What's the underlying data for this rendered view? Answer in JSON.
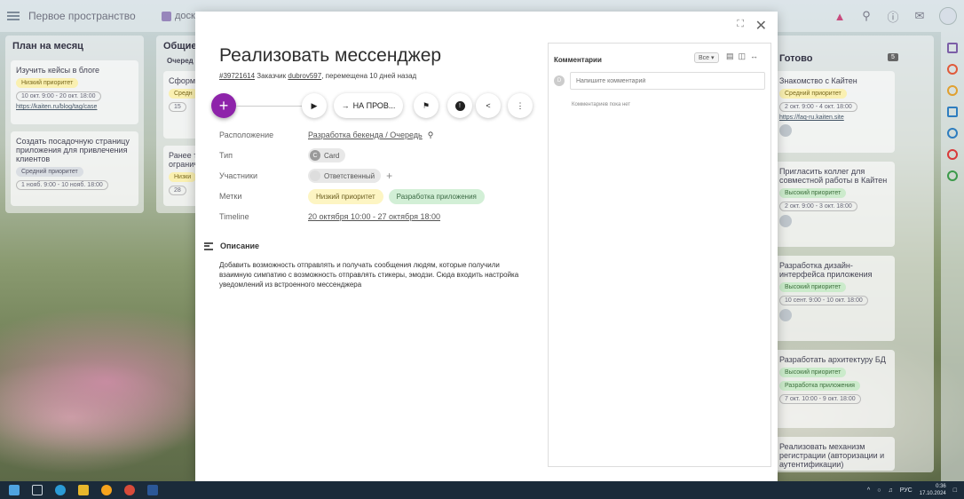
{
  "topbar": {
    "space_name": "Первое пространство",
    "board_label": "доск"
  },
  "columns": {
    "plan": {
      "title": "План на месяц",
      "cards": [
        {
          "text": "Изучить кейсы в блоге",
          "pill": "Низкий приоритет",
          "date": "10 окт. 9:00 - 20 окт. 18:00",
          "link": "https://kaiten.ru/blog/tag/case"
        },
        {
          "text": "Создать посадочную страницу приложения для привлечения клиентов",
          "pill": "Средний приоритет",
          "date": "1 нояб. 9:00 - 10 нояб. 18:00"
        }
      ]
    },
    "general": {
      "title": "Общие",
      "subtitle": "Очеред",
      "cards": [
        {
          "text": "Сформ",
          "pill": "Средн",
          "date": "15"
        },
        {
          "text": "Ранее т огранич",
          "pill": "Низки",
          "date": "28"
        }
      ]
    },
    "done": {
      "title": "Готово",
      "count": "5",
      "cards": [
        {
          "text": "Знакомство с Кайтен",
          "pill": "Средний приоритет",
          "date": "2 окт. 9:00 - 4 окт. 18:00",
          "link": "https://faq-ru.kaiten.site"
        },
        {
          "text": "Пригласить коллег для совместной работы в Кайтен",
          "pill": "Высокий приоритет",
          "date": "2 окт. 9:00 - 3 окт. 18:00"
        },
        {
          "text": "Разработка дизайн-интерфейса приложения",
          "pill": "Высокий приоритет",
          "date": "10 сент. 9:00 - 10 окт. 18:00"
        },
        {
          "text": "Разработать архитектуру БД",
          "pill": "Высокий приоритет",
          "pill2": "Разработка приложения",
          "date": "7 окт. 10:00 - 9 окт. 18:00"
        },
        {
          "text": "Реализовать механизм регистрации (авторизации и аутентификации)"
        }
      ]
    }
  },
  "modal": {
    "title": "Реализовать мессенджер",
    "card_id": "#39721614",
    "customer_label": "Заказчик",
    "customer": "dubrov597",
    "moved": ", перемещена 10 дней назад",
    "fab": "+",
    "move_button": "НА ПРОВ...",
    "props": {
      "location_label": "Расположение",
      "location_value": "Разработка бекенда / Очередь",
      "type_label": "Тип",
      "type_letter": "C",
      "type_value": "Card",
      "members_label": "Участники",
      "members_value": "Ответственный",
      "tags_label": "Метки",
      "tag1": "Низкий приоритет",
      "tag2": "Разработка приложения",
      "timeline_label": "Timeline",
      "timeline_value": "20 октября 10:00 - 27 октября 18:00"
    },
    "description_title": "Описание",
    "description": "Добавить возможность отправлять и получать сообщения людям, которые получили взаимную симпатию с возможность отправлять стикеры, эмодзи. Сюда входить настройка уведомлений из встроенного мессенджера"
  },
  "comments": {
    "title": "Комментарии",
    "filter": "Все",
    "avatar_letter": "D",
    "placeholder": "Напишите комментарий",
    "empty": "Комментариев пока нет"
  },
  "taskbar": {
    "lang": "РУС",
    "time": "0:36",
    "date": "17.10.2024"
  },
  "colors": {
    "accent": "#8e24aa"
  }
}
